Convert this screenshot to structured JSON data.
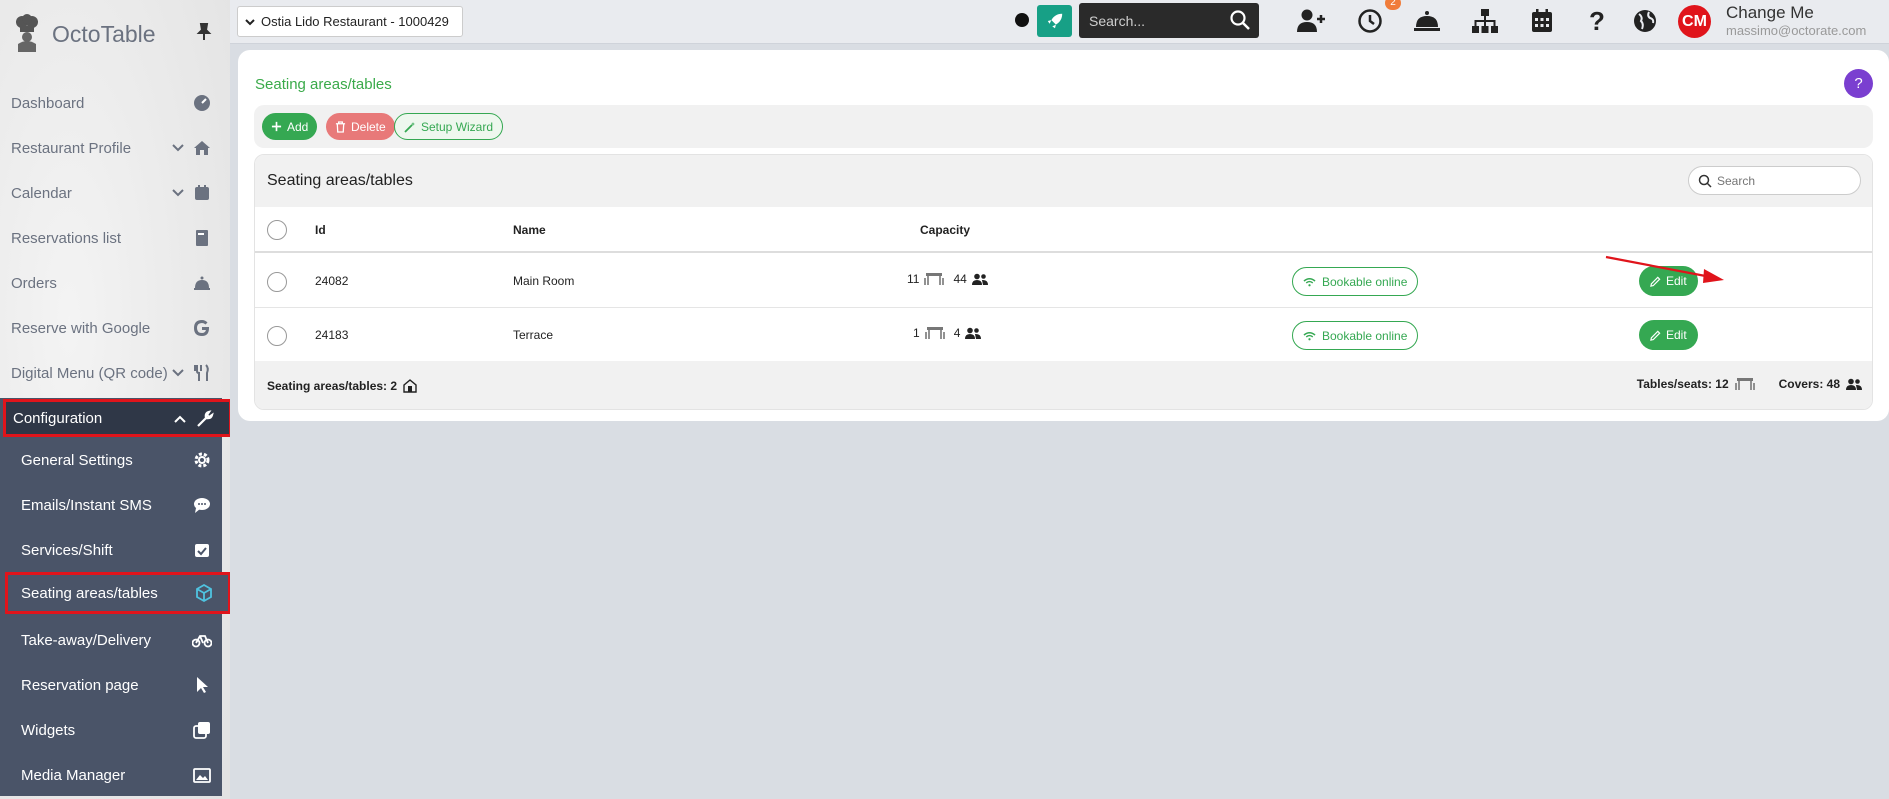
{
  "brand": {
    "name": "OctoTable"
  },
  "sidebar": {
    "items": [
      {
        "label": "Dashboard",
        "icon": "dashboard-icon"
      },
      {
        "label": "Restaurant Profile",
        "icon": "home-icon"
      },
      {
        "label": "Calendar",
        "icon": "calendar-icon"
      },
      {
        "label": "Reservations list",
        "icon": "book-icon"
      },
      {
        "label": "Orders",
        "icon": "bell-icon"
      },
      {
        "label": "Reserve with Google",
        "icon": "google-icon"
      },
      {
        "label": "Digital Menu (QR code)",
        "icon": "utensils-icon"
      }
    ],
    "config": {
      "label": "Configuration",
      "items": [
        {
          "label": "General Settings",
          "icon": "gear-icon"
        },
        {
          "label": "Emails/Instant SMS",
          "icon": "chat-icon"
        },
        {
          "label": "Services/Shift",
          "icon": "calendar-check-icon"
        },
        {
          "label": "Seating areas/tables",
          "icon": "cube-icon"
        },
        {
          "label": "Take-away/Delivery",
          "icon": "bike-icon"
        },
        {
          "label": "Reservation page",
          "icon": "pointer-icon"
        },
        {
          "label": "Widgets",
          "icon": "widgets-icon"
        },
        {
          "label": "Media Manager",
          "icon": "image-icon"
        }
      ]
    }
  },
  "topbar": {
    "restaurant": "Ostia Lido Restaurant - 1000429",
    "search_placeholder": "Search...",
    "badge_count": "2",
    "avatar_initials": "CM",
    "user_name": "Change Me",
    "user_email": "massimo@octorate.com"
  },
  "page": {
    "title": "Seating areas/tables",
    "help": "?",
    "buttons": {
      "add": "Add",
      "delete": "Delete",
      "wizard": "Setup Wizard"
    },
    "table_title": "Seating areas/tables",
    "search_placeholder": "Search",
    "columns": {
      "id": "Id",
      "name": "Name",
      "capacity": "Capacity"
    },
    "rows": [
      {
        "id": "24082",
        "name": "Main Room",
        "tables": "11",
        "covers": "44",
        "status": "Bookable online",
        "action": "Edit"
      },
      {
        "id": "24183",
        "name": "Terrace",
        "tables": "1",
        "covers": "4",
        "status": "Bookable online",
        "action": "Edit"
      }
    ],
    "footer": {
      "count_label": "Seating areas/tables: 2",
      "tables_label": "Tables/seats: 12",
      "covers_label": "Covers: 48"
    }
  },
  "colors": {
    "accent": "#35a852",
    "highlight": "#e0141b",
    "sidebar_dark": "#4a5468"
  }
}
